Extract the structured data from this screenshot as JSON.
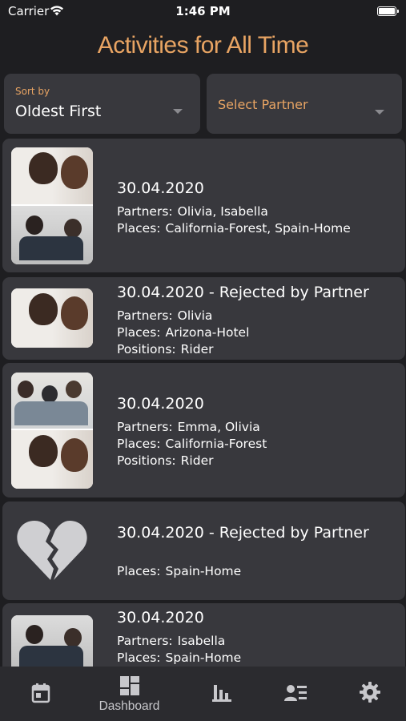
{
  "status_bar": {
    "carrier": "Carrier",
    "time": "1:46 PM"
  },
  "page_title": "Activities for All Time",
  "filters": {
    "sort": {
      "label": "Sort by",
      "value": "Oldest First"
    },
    "partner": {
      "placeholder": "Select Partner"
    }
  },
  "activities": [
    {
      "date": "30.04.2020",
      "partners_label": "Partners:",
      "partners": "Olivia, Isabella",
      "places_label": "Places:",
      "places": "California-Forest, Spain-Home",
      "image": "photo-collage"
    },
    {
      "date": "30.04.2020 - Rejected by Partner",
      "partners_label": "Partners:",
      "partners": "Olivia",
      "places_label": "Places:",
      "places": "Arizona-Hotel",
      "positions_label": "Positions:",
      "positions": "Rider",
      "image": "photo"
    },
    {
      "date": "30.04.2020",
      "partners_label": "Partners:",
      "partners": "Emma, Olivia",
      "places_label": "Places:",
      "places": "California-Forest",
      "positions_label": "Positions:",
      "positions": "Rider",
      "image": "photo-collage"
    },
    {
      "date": "30.04.2020 - Rejected by Partner",
      "places_label": "Places:",
      "places": "Spain-Home",
      "image": "broken-heart-icon"
    },
    {
      "date": "30.04.2020",
      "partners_label": "Partners:",
      "partners": "Isabella",
      "places_label": "Places:",
      "places": "Spain-Home",
      "image": "photo-collage"
    }
  ],
  "tab_bar": {
    "tabs": [
      {
        "icon": "calendar-icon",
        "label": ""
      },
      {
        "icon": "dashboard-icon",
        "label": "Dashboard"
      },
      {
        "icon": "bar-chart-icon",
        "label": ""
      },
      {
        "icon": "contacts-list-icon",
        "label": ""
      },
      {
        "icon": "gear-icon",
        "label": ""
      }
    ]
  },
  "colors": {
    "background": "#1e1e21",
    "card": "#38383d",
    "accent": "#e8a463",
    "tab_bar": "#2b2b2f",
    "icon": "#c8c8cc"
  }
}
